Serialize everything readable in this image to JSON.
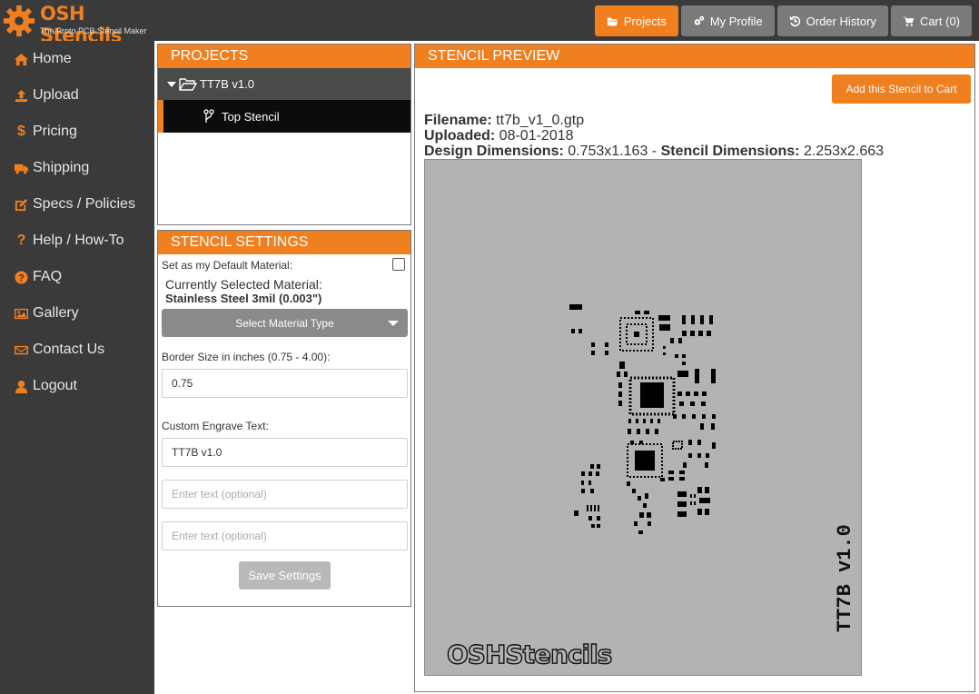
{
  "app": {
    "brand": "OSH Stencils",
    "tagline": "The Proto PCB Stencil Maker"
  },
  "topnav": [
    {
      "label": "Projects",
      "icon": "folder-open-icon",
      "active": true
    },
    {
      "label": "My Profile",
      "icon": "gears-icon",
      "active": false
    },
    {
      "label": "Order History",
      "icon": "history-icon",
      "active": false
    },
    {
      "label": "Cart (0)",
      "icon": "cart-icon",
      "active": false
    }
  ],
  "sidebar": [
    {
      "label": "Home",
      "icon": "home-icon"
    },
    {
      "label": "Upload",
      "icon": "upload-icon"
    },
    {
      "label": "Pricing",
      "icon": "dollar-icon"
    },
    {
      "label": "Shipping",
      "icon": "truck-icon"
    },
    {
      "label": "Specs / Policies",
      "icon": "edit-icon"
    },
    {
      "label": "Help / How-To",
      "icon": "question-icon"
    },
    {
      "label": "FAQ",
      "icon": "question-circle-icon"
    },
    {
      "label": "Gallery",
      "icon": "picture-icon"
    },
    {
      "label": "Contact Us",
      "icon": "envelope-icon"
    },
    {
      "label": "Logout",
      "icon": "user-icon"
    }
  ],
  "projects": {
    "title": "PROJECTS",
    "project_name": "TT7B v1.0",
    "stencil_name": "Top Stencil"
  },
  "settings": {
    "title": "STENCIL SETTINGS",
    "default_material_label": "Set as my Default Material:",
    "current_material_label": "Currently Selected Material:",
    "current_material_value": "Stainless Steel 3mil (0.003\")",
    "select_material_label": "Select Material Type",
    "border_label": "Border Size in inches (0.75 - 4.00):",
    "border_value": "0.75",
    "engrave_label": "Custom Engrave Text:",
    "engrave_value": "TT7B v1.0",
    "extra_placeholder_1": "Enter text (optional)",
    "extra_placeholder_2": "Enter text (optional)",
    "save_label": "Save Settings"
  },
  "preview": {
    "title": "STENCIL PREVIEW",
    "add_to_cart_label": "Add this Stencil to Cart",
    "filename_label": "Filename:",
    "filename_value": "tt7b_v1_0.gtp",
    "uploaded_label": "Uploaded:",
    "uploaded_value": "08-01-2018",
    "design_dim_label": "Design Dimensions:",
    "design_dim_value": "0.753x1.163",
    "separator": "-",
    "stencil_dim_label": "Stencil Dimensions:",
    "stencil_dim_value": "2.253x2.663",
    "watermark": "OSHStencils",
    "engrave_text": "TT7B v1.0"
  },
  "colors": {
    "accent": "#f07f1f",
    "dark_bg": "#3a3a3a",
    "stencil_bg": "#b3b3b3"
  }
}
